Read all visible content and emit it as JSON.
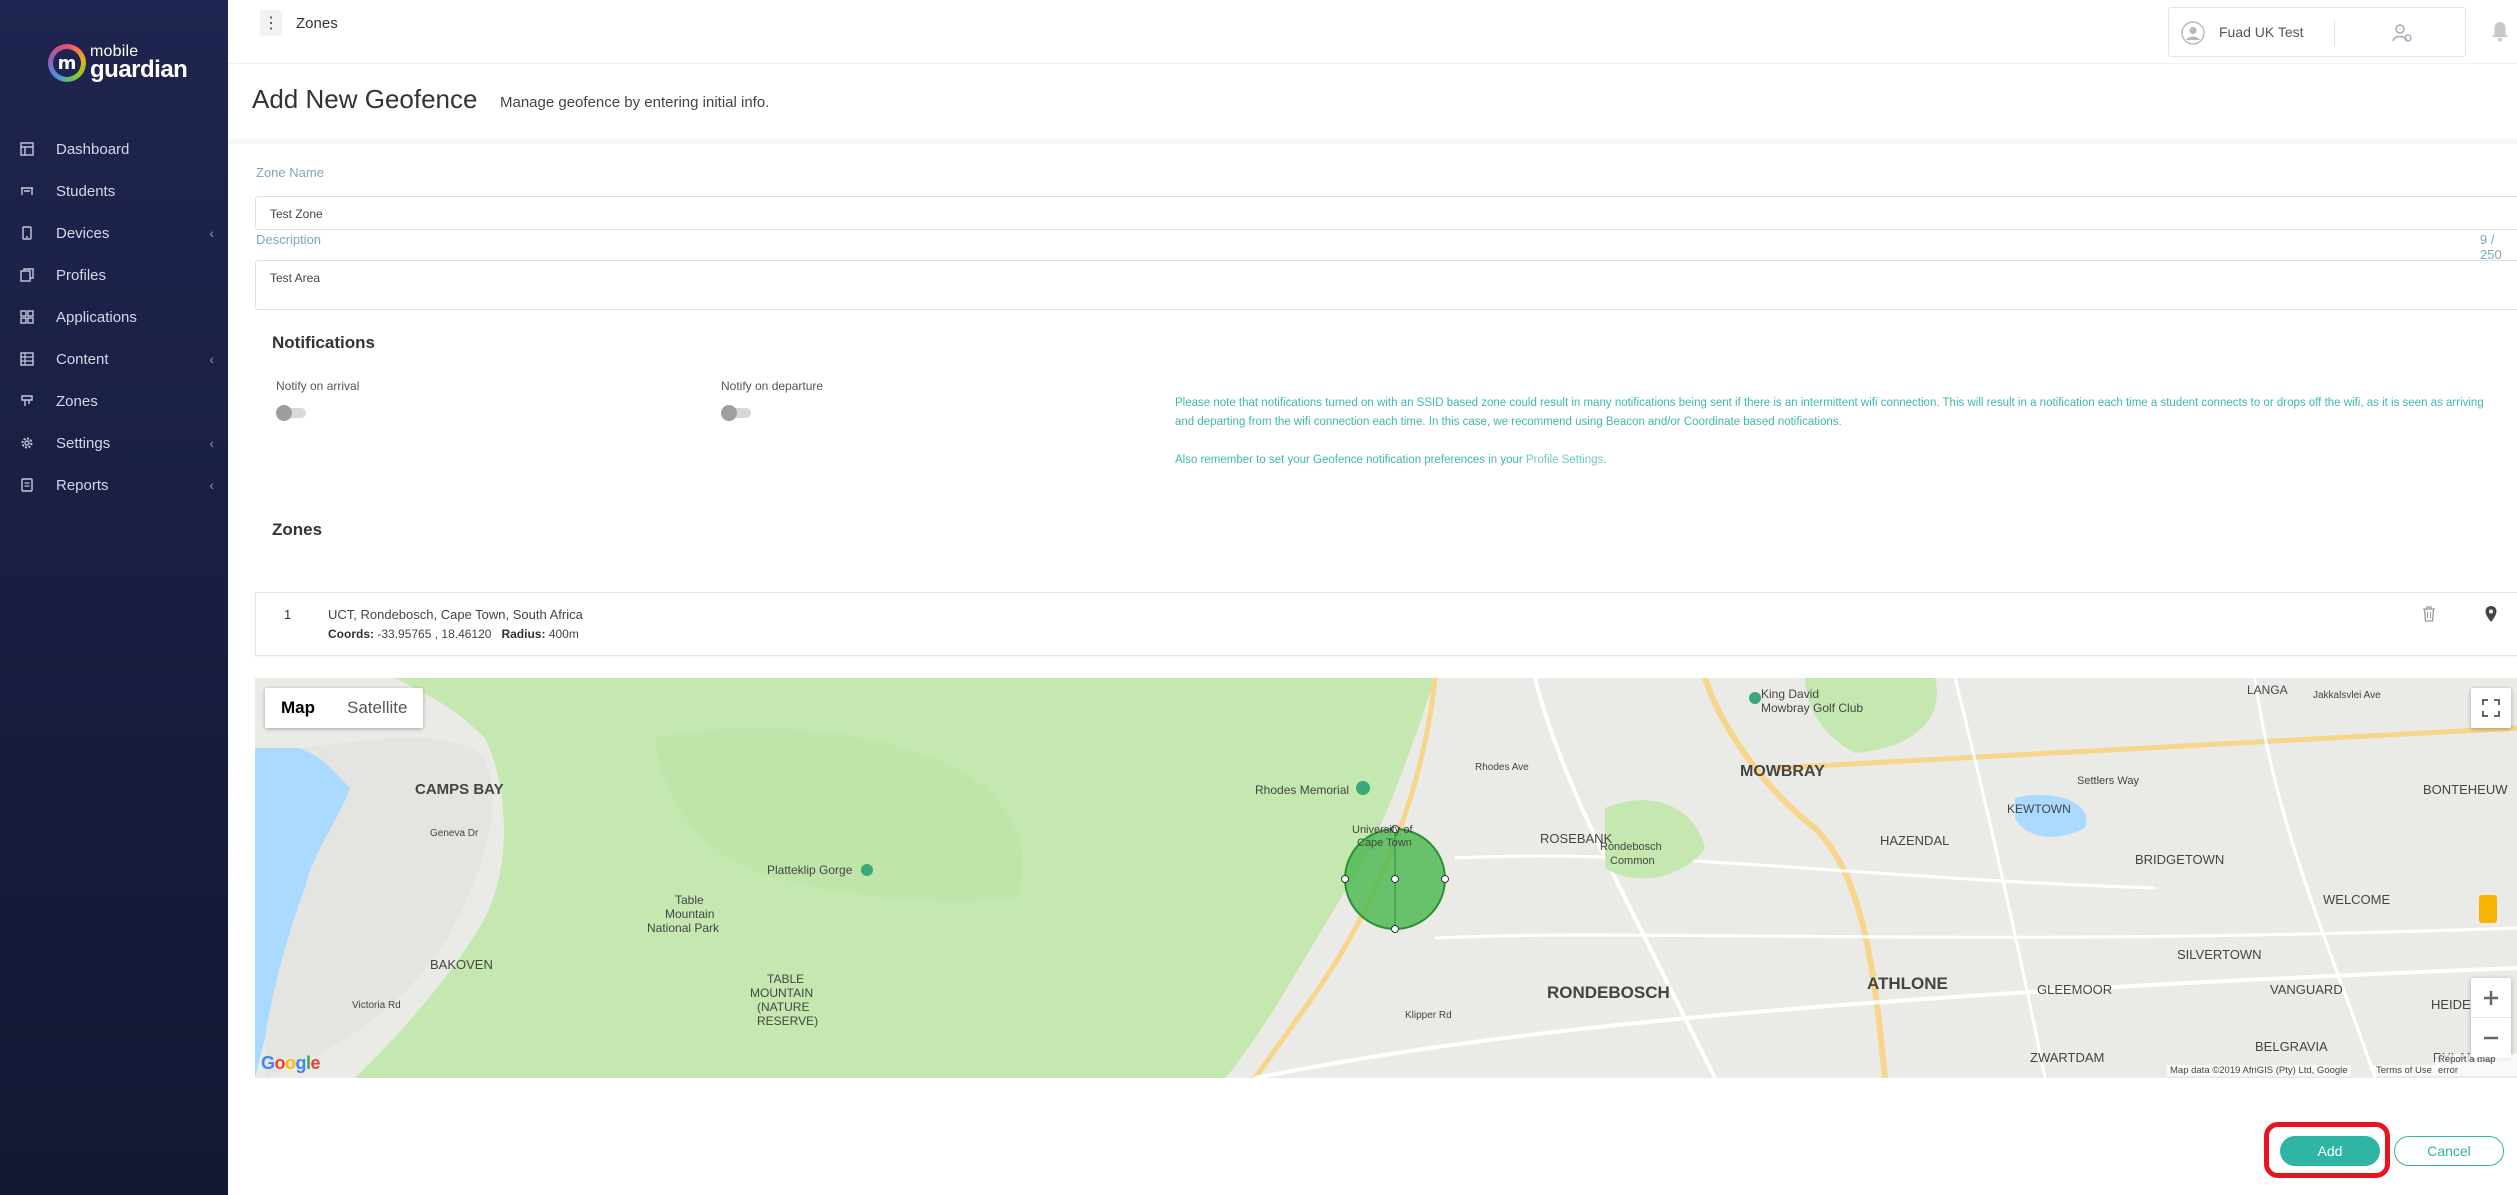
{
  "app": {
    "logo_line1": "mobile",
    "logo_line2": "guardian",
    "logo_mark": "m"
  },
  "sidebar": {
    "items": [
      {
        "label": "Dashboard",
        "icon": "dashboard-icon",
        "has_children": false
      },
      {
        "label": "Students",
        "icon": "students-icon",
        "has_children": false
      },
      {
        "label": "Devices",
        "icon": "device-icon",
        "has_children": true
      },
      {
        "label": "Profiles",
        "icon": "profiles-icon",
        "has_children": false
      },
      {
        "label": "Applications",
        "icon": "applications-icon",
        "has_children": false
      },
      {
        "label": "Content",
        "icon": "content-icon",
        "has_children": true
      },
      {
        "label": "Zones",
        "icon": "zones-icon",
        "has_children": false
      },
      {
        "label": "Settings",
        "icon": "gear-icon",
        "has_children": true
      },
      {
        "label": "Reports",
        "icon": "reports-icon",
        "has_children": true
      }
    ],
    "chevron": "‹"
  },
  "header": {
    "breadcrumb": "Zones",
    "kebab": "⋮",
    "user_name": "Fuad UK Test"
  },
  "page": {
    "title": "Add New Geofence",
    "subtitle": "Manage geofence by entering initial info."
  },
  "form": {
    "zone_name_label": "Zone Name",
    "zone_name_value": "Test Zone",
    "description_label": "Description",
    "description_value": "Test Area",
    "description_counter": "9 / 250"
  },
  "notifications": {
    "heading": "Notifications",
    "arrival_label": "Notify on arrival",
    "arrival_on": false,
    "departure_label": "Notify on departure",
    "departure_on": false,
    "note_1": "Please note that notifications turned on with an SSID based zone could result in many notifications being sent if there is an intermittent wifi connection. This will result in a notification each time a student connects to or drops off the wifi, as it is seen as arriving and departing from the wifi connection each time. In this case, we recommend using Beacon and/or Coordinate based notifications.",
    "note_2_prefix": "Also remember to set your Geofence notification preferences in your ",
    "note_2_link": "Profile Settings",
    "note_2_suffix": "."
  },
  "zones": {
    "heading": "Zones",
    "list": [
      {
        "index": "1",
        "address": "UCT, Rondebosch, Cape Town, South Africa",
        "coords_label": "Coords:",
        "coords_value": "-33.95765 , 18.46120",
        "radius_label": "Radius:",
        "radius_value": "400m"
      }
    ]
  },
  "map": {
    "tab_map": "Map",
    "tab_satellite": "Satellite",
    "active_tab": "Map",
    "attribution": "Map data ©2019 AfriGIS (Pty) Ltd, Google",
    "terms": "Terms of Use",
    "report": "Report a map error",
    "google": "Google",
    "places": [
      "CAMPS BAY",
      "Rhodes Memorial",
      "ROSEBANK",
      "MOWBRAY",
      "KEWTOWN",
      "HAZENDAL",
      "BRIDGETOWN",
      "Rondebosch Common",
      "Platteklip Gorge",
      "Table Mountain National Park",
      "BAKOVEN",
      "TABLE MOUNTAIN (NATURE RESERVE)",
      "RONDEBOSCH",
      "ATHLONE",
      "GLEEMOOR",
      "SILVERTOWN",
      "VANGUARD",
      "WELCOME",
      "BONTEHEUWEL",
      "LANGA",
      "King David Mowbray Golf Club",
      "ZWARTDAM",
      "BELGRAVIA",
      "RYLANDS",
      "HEIDE",
      "University of Cape Town",
      "Settlers Way",
      "Jakkalsvlei Ave",
      "Klipper Rd",
      "Rhodes Ave",
      "Victoria Rd",
      "Geneva Dr"
    ]
  },
  "actions": {
    "add": "Add",
    "cancel": "Cancel"
  },
  "colors": {
    "accent": "#2fb5a4",
    "sidebar_bg": "#1f2550",
    "note_text": "#3fb8a9",
    "highlight": "#e8141f",
    "park_green": "#c5e8b0",
    "water": "#aadaff"
  }
}
